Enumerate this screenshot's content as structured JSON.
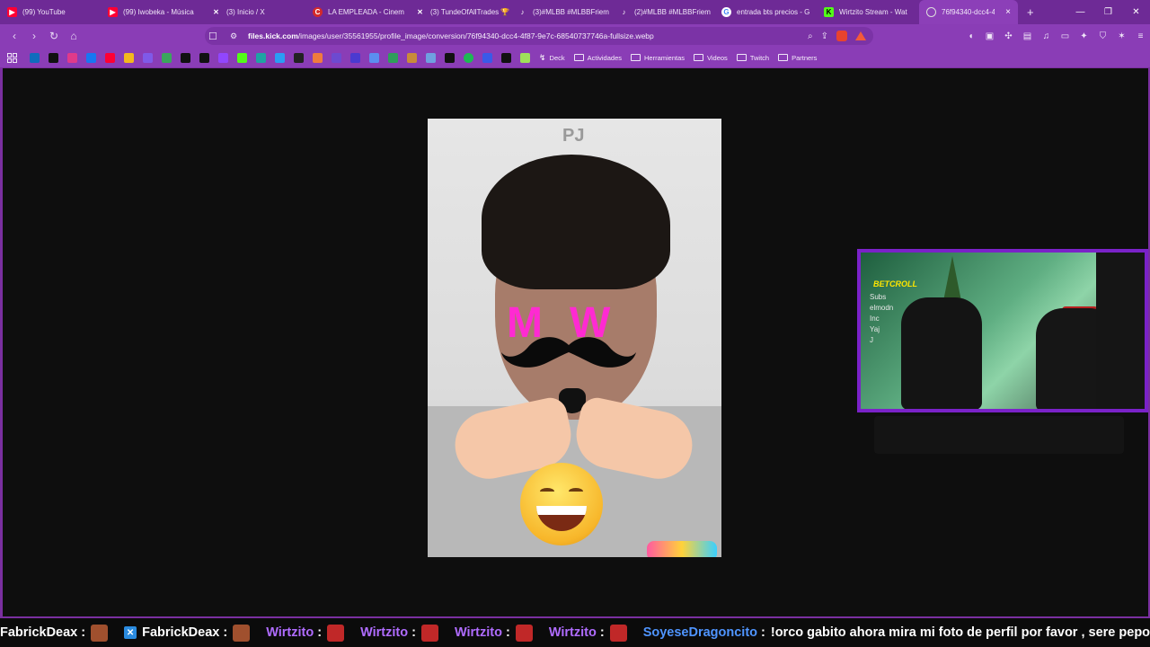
{
  "browser": {
    "tabs": [
      {
        "label": "(99) YouTube",
        "icon": "youtube-icon",
        "color": "#ff0033"
      },
      {
        "label": "(99) Iwobeka - Música",
        "icon": "youtube-icon",
        "color": "#ff0033"
      },
      {
        "label": "(3) Inicio / X",
        "icon": "x-icon",
        "color": "#000000"
      },
      {
        "label": "LA EMPLEADA - Cinem",
        "icon": "cinema-icon",
        "color": "#d42a2a"
      },
      {
        "label": "(3) TundeOfAllTrades 🏆",
        "icon": "x-icon",
        "color": "#000000"
      },
      {
        "label": "(3)#MLBB #MLBBFriem",
        "icon": "tiktok-icon",
        "color": "#111111"
      },
      {
        "label": "(2)#MLBB #MLBBFriem",
        "icon": "tiktok-icon",
        "color": "#111111"
      },
      {
        "label": "entrada bts precios - G",
        "icon": "google-icon",
        "color": "#4285f4"
      },
      {
        "label": "Wirtzito Stream - Wat",
        "icon": "kick-icon",
        "color": "#53fc18"
      },
      {
        "label": "76f94340-dcc4-4f",
        "icon": "globe-icon",
        "color": "#9a9a9a",
        "active": true
      }
    ],
    "close_symbol": "×",
    "new_tab_symbol": "+",
    "url_domain": "files.kick.com",
    "url_path": "/images/user/35561955/profile_image/conversion/76f94340-dcc4-4f87-9e7c-68540737746a-fullsize.webp",
    "bookmarks": {
      "folders": [
        "Deck",
        "Actividades",
        "Herramientas",
        "Videos",
        "Twitch",
        "Partners"
      ]
    }
  },
  "image": {
    "watermark_top": "PJ",
    "sticker_text": "MW"
  },
  "webcam": {
    "brand_text": "BETCROLL",
    "overlay_lines": [
      "Subs",
      "elmodn",
      "Inc",
      "Yaj",
      "J"
    ]
  },
  "ticker": {
    "messages": [
      {
        "user": "FabrickDeax",
        "style": "white",
        "text": ""
      },
      {
        "user": "FabrickDeax",
        "style": "white",
        "text": "",
        "badge": true
      },
      {
        "user": "Wirtzito",
        "style": "purple",
        "text": ""
      },
      {
        "user": "Wirtzito",
        "style": "purple",
        "text": ""
      },
      {
        "user": "Wirtzito",
        "style": "purple",
        "text": ""
      },
      {
        "user": "Wirtzito",
        "style": "purple",
        "text": ""
      },
      {
        "user": "SoyeseDragoncito",
        "style": "blue",
        "text": "!orco gabito ahora mira mi foto de perfil por favor , sere pepon?"
      }
    ]
  },
  "colors": {
    "browser_frame": "#8a3db6",
    "webcam_border": "#7a22c8",
    "kick_green": "#53fc18"
  }
}
